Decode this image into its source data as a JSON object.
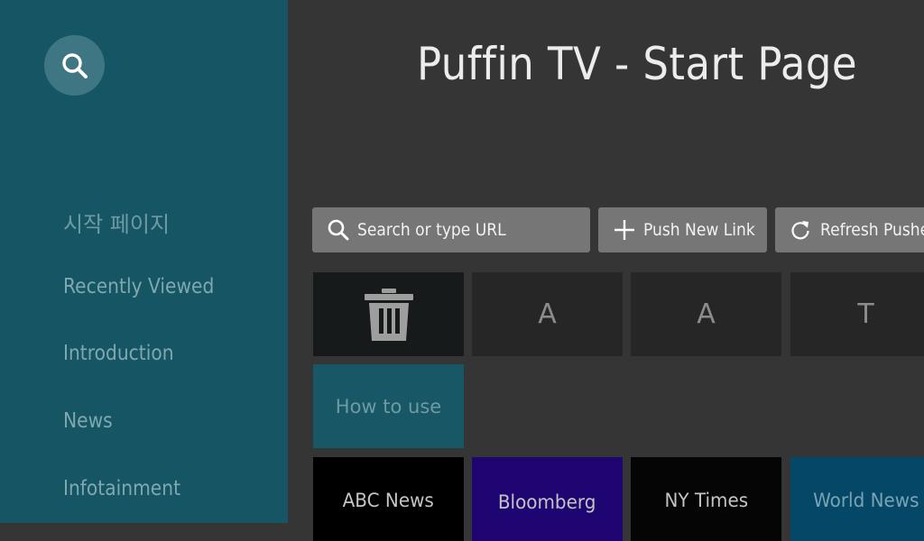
{
  "app": {
    "title": "Puffin TV - Start Page"
  },
  "sidebar": {
    "search_icon": "search-icon",
    "items": [
      {
        "label": "시작 페이지"
      },
      {
        "label": "Recently Viewed"
      },
      {
        "label": "Introduction"
      },
      {
        "label": "News"
      },
      {
        "label": "Infotainment"
      }
    ]
  },
  "toolbar": {
    "search": {
      "label": "Search or type URL",
      "icon": "search-icon"
    },
    "push": {
      "label": "Push New Link",
      "icon": "plus-icon"
    },
    "refresh": {
      "label": "Refresh Pushed Links",
      "icon": "refresh-icon"
    }
  },
  "tiles": {
    "row1": [
      {
        "type": "trash",
        "icon": "trash-icon"
      },
      {
        "label": "A"
      },
      {
        "label": "A"
      },
      {
        "label": "T"
      }
    ],
    "how_to_use": {
      "label": "How to use"
    },
    "news": [
      {
        "label": "ABC News",
        "color": "#000000"
      },
      {
        "label": "Bloomberg",
        "color": "#1f0572"
      },
      {
        "label": "NY Times",
        "color": "#050505"
      },
      {
        "label": "World News",
        "color": "#054766"
      }
    ]
  },
  "colors": {
    "sidebar_bg": "#155564",
    "main_bg": "#353535",
    "button_bg": "#767676",
    "tile_bg": "#262626",
    "how_to_use_bg": "#185866"
  }
}
